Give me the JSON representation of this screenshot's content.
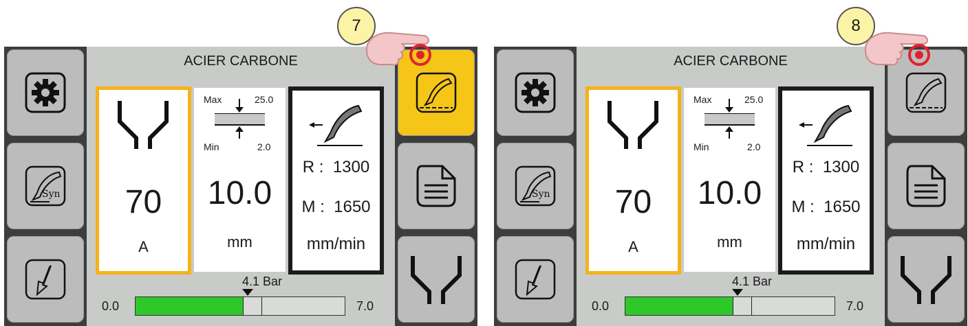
{
  "screens": [
    {
      "id": "left",
      "title": "ACIER CARBONE",
      "callout": "7",
      "active_right_button": "torch-synergic",
      "current": {
        "value": "70",
        "unit": "A"
      },
      "thickness": {
        "value": "10.0",
        "unit": "mm",
        "max_label": "Max",
        "max_value": "25.0",
        "min_label": "Min",
        "min_value": "2.0"
      },
      "speed": {
        "r_label": "R :",
        "r_value": "1300",
        "m_label": "M :",
        "m_value": "1650",
        "unit": "mm/min"
      },
      "pressure": {
        "label": "4.1 Bar",
        "min": "0.0",
        "max": "7.0",
        "level_fraction": 0.586
      }
    },
    {
      "id": "right",
      "title": "ACIER CARBONE",
      "callout": "8",
      "active_right_button": "",
      "current": {
        "value": "70",
        "unit": "A"
      },
      "thickness": {
        "value": "10.0",
        "unit": "mm",
        "max_label": "Max",
        "max_value": "25.0",
        "min_label": "Min",
        "min_value": "2.0"
      },
      "speed": {
        "r_label": "R :",
        "r_value": "1300",
        "m_label": "M :",
        "m_value": "1650",
        "unit": "mm/min"
      },
      "pressure": {
        "label": "4.1 Bar",
        "min": "0.0",
        "max": "7.0",
        "level_fraction": 0.586
      }
    }
  ],
  "left_buttons": {
    "settings_icon": "gear-icon",
    "syn_icon": "torch-syn-icon",
    "syn_label": "Syn",
    "download_icon": "arrow-down-icon"
  },
  "right_buttons": {
    "torch_icon": "torch-icon",
    "file_icon": "document-icon",
    "nozzle_icon": "nozzle-icon"
  },
  "colors": {
    "active": "#f5c518",
    "current_border": "#f6b21b",
    "gauge_fill": "#2ec82a",
    "callout_bg": "#fbf3a6",
    "touch_ring": "#e0232e"
  }
}
